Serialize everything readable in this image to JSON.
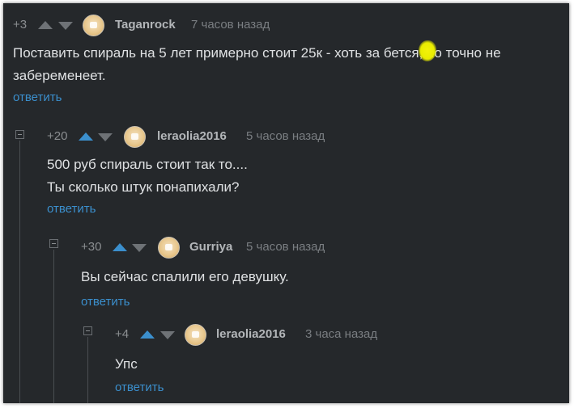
{
  "comments": [
    {
      "rating": "+3",
      "username": "Taganrock",
      "time": "7 часов назад",
      "text_line1": "Поставить спираль на 5 лет примерно стоит 25к - хоть за бется, но точно не",
      "text_line2": "забеременеет.",
      "reply": "ответить",
      "up_active": false
    },
    {
      "rating": "+20",
      "username": "leraolia2016",
      "time": "5 часов назад",
      "text_line1": "500 руб спираль стоит так то....",
      "text_line2": "Ты сколько штук понапихали?",
      "reply": "ответить",
      "up_active": true
    },
    {
      "rating": "+30",
      "username": "Gurriya",
      "time": "5 часов назад",
      "text_line1": "Вы сейчас спалили его девушку.",
      "reply": "ответить",
      "up_active": true
    },
    {
      "rating": "+4",
      "username": "leraolia2016",
      "time": "3 часа назад",
      "text_line1": "Упс",
      "reply": "ответить",
      "up_active": true
    }
  ],
  "colors": {
    "background": "#25282b",
    "link": "#3b8fcd",
    "text": "#dfe1e3",
    "upvote_active": "#3b8fcd"
  },
  "icons": [
    "upvote-arrow-icon",
    "downvote-arrow-icon",
    "avatar",
    "collapse-icon",
    "yellow-censor-blob"
  ]
}
